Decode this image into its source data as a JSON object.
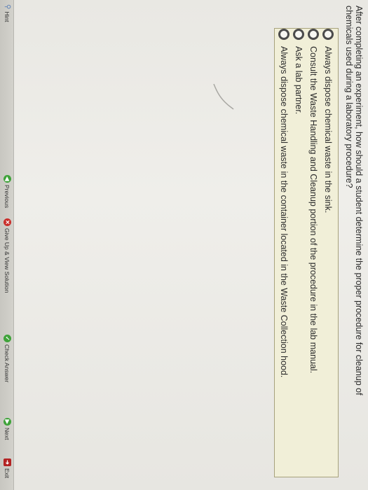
{
  "question": {
    "line1": "After completing an experiment, how should a student determine the proper procedure for cleanup of",
    "line2": "chemicals used during a laboratory procedure?"
  },
  "choices": [
    {
      "label": "Always dispose chemical waste in the sink."
    },
    {
      "label": "Consult the Waste Handling and Cleanup portion of the procedure in the lab manual."
    },
    {
      "label": "Ask a lab partner."
    },
    {
      "label": "Always dispose chemical waste in the container located in the Waste Collection hood."
    }
  ],
  "toolbar": {
    "hint": "Hint",
    "previous": "Previous",
    "give_up": "Give Up & View Solution",
    "check": "Check Answer",
    "next": "Next",
    "exit": "Exit"
  },
  "colors": {
    "choice_box_bg": "#f1efd8",
    "green_icon": "#3fa33a",
    "red_icon": "#c9302c"
  }
}
